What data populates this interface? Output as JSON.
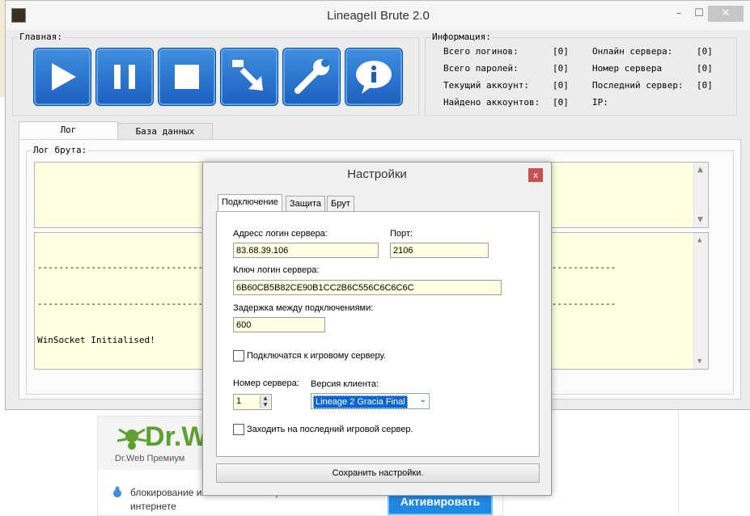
{
  "window": {
    "title": "LineageII Brute 2.0"
  },
  "main_group": {
    "label": "Главная:"
  },
  "info": {
    "label": "Информация:",
    "rows_left": [
      {
        "label": "Всего логинов:",
        "value": "[0]"
      },
      {
        "label": "Всего паролей:",
        "value": "[0]"
      },
      {
        "label": "Текущий аккоунт:",
        "value": "[0]"
      },
      {
        "label": "Найдено аккоунтов:",
        "value": "[0]"
      }
    ],
    "rows_right": [
      {
        "label": "Онлайн сервера:",
        "value": "[0]"
      },
      {
        "label": "Номер сервера",
        "value": "[0]"
      },
      {
        "label": "Последний сервер:",
        "value": "[0]"
      },
      {
        "label": "IP:",
        "value": ""
      }
    ]
  },
  "tabs": [
    "Лог",
    "База данных"
  ],
  "log": {
    "group_label": "Лог брута:",
    "lines": [
      "------------------------------------------------------------------------------------------------------------",
      "------------------------------------------------------------------------------------------------------------",
      "WinSocket Initialised!"
    ]
  },
  "dialog": {
    "title": "Настройки",
    "close": "x",
    "tabs": [
      "Подключение",
      "Защита",
      "Брут"
    ],
    "login_server_label": "Адресс логин сервера:",
    "login_server_value": "83.68.39.106",
    "port_label": "Порт:",
    "port_value": "2106",
    "key_label": "Ключ логин сервера:",
    "key_value": "6B60CB5B82CE90B1CC2B6C556C6C6C6C",
    "delay_label": "Задержка между подключениями:",
    "delay_value": "600",
    "connect_game_label": "Подключатся к игровому серверу.",
    "connect_game_checked": false,
    "server_num_label": "Номер сервера:",
    "server_num_value": "1",
    "client_version_label": "Версия клиента:",
    "client_version_value": "Lineage 2 Gracia Final",
    "last_server_label": "Заходить на последний игровой сервер.",
    "last_server_checked": false,
    "save_label": "Сохранить настройки."
  },
  "ad": {
    "logo": "Dr.W",
    "subtitle": "Dr.Web Премиум",
    "text": "блокирование и                                         платежей и общения в интернете",
    "button": "Активировать"
  },
  "colors": {
    "accent_button": "#1e88e5",
    "log_background": "#ffffe1",
    "drweb_green": "#5ca22e"
  }
}
